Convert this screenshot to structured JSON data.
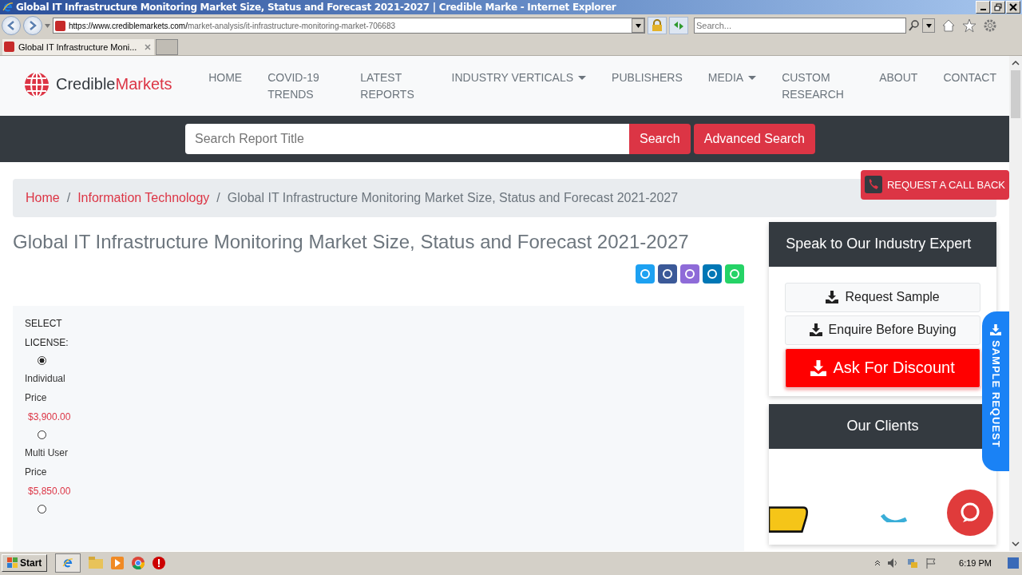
{
  "window": {
    "title": "Global IT Infrastructure Monitoring Market Size, Status and Forecast 2021-2027 | Credible Marke - Internet Explorer"
  },
  "address_bar": {
    "host": "https://www.crediblemarkets.com/",
    "path": "market-analysis/it-infrastructure-monitoring-market-706683"
  },
  "search_box": {
    "placeholder": "Search..."
  },
  "tabs": [
    {
      "label": "Global IT Infrastructure Moni...",
      "selected": true
    }
  ],
  "site": {
    "logo_first": "Credible",
    "logo_second": "Markets",
    "nav": [
      {
        "label": "HOME",
        "has_menu": false
      },
      {
        "label": "COVID-19 TRENDS",
        "has_menu": false
      },
      {
        "label": "LATEST REPORTS",
        "has_menu": false
      },
      {
        "label": "INDUSTRY VERTICALS",
        "has_menu": true
      },
      {
        "label": "PUBLISHERS",
        "has_menu": false
      },
      {
        "label": "MEDIA",
        "has_menu": true
      },
      {
        "label": "CUSTOM RESEARCH",
        "has_menu": false
      },
      {
        "label": "ABOUT",
        "has_menu": false
      },
      {
        "label": "CONTACT",
        "has_menu": false
      }
    ],
    "search": {
      "placeholder": "Search Report Title",
      "button": "Search",
      "advanced": "Advanced Search"
    },
    "call_back": "REQUEST A CALL BACK",
    "breadcrumb_separator": "/",
    "breadcrumb": [
      "Home",
      "Information Technology",
      "Global IT Infrastructure Monitoring Market Size, Status and Forecast 2021-2027"
    ],
    "report_title": "Global IT Infrastructure Monitoring Market Size, Status and Forecast 2021-2027",
    "license_heading": "SELECT LICENSE:",
    "licenses": [
      {
        "label": "Individual Price",
        "price": "$3,900.00",
        "selected": true
      },
      {
        "label": "Multi User Price",
        "price": "$5,850.00",
        "selected": false
      },
      {
        "selected": false
      }
    ],
    "expert": {
      "title": "Speak to Our Industry Expert",
      "buttons": [
        {
          "label": "Request Sample",
          "kind": "plain"
        },
        {
          "label": "Enquire Before Buying",
          "kind": "plain"
        },
        {
          "label": "Ask For Discount",
          "kind": "primary"
        }
      ]
    },
    "clients_title": "Our Clients",
    "sample_tab": "SAMPLE REQUEST"
  },
  "taskbar": {
    "start": "Start",
    "time": "6:19 PM"
  }
}
